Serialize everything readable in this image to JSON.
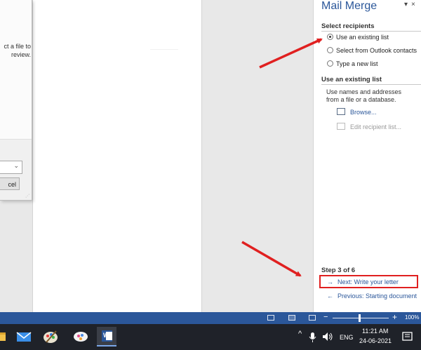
{
  "dialog": {
    "text_line1": "ct a file to",
    "text_line2": "review.",
    "cancel_label": "cel"
  },
  "pane": {
    "title": "Mail Merge",
    "dropdown_glyph": "▾",
    "close_glyph": "×",
    "select_recipients": {
      "heading": "Select recipients",
      "options": [
        {
          "label": "Use an existing list",
          "selected": true
        },
        {
          "label": "Select from Outlook contacts",
          "selected": false
        },
        {
          "label": "Type a new list",
          "selected": false
        }
      ]
    },
    "existing_list": {
      "heading": "Use an existing list",
      "description_line1": "Use names and addresses",
      "description_line2": "from a file or a database.",
      "browse_label": "Browse...",
      "edit_label": "Edit recipient list..."
    },
    "step": {
      "label": "Step 3 of 6",
      "next_label": "Next: Write your letter",
      "previous_label": "Previous: Starting document"
    }
  },
  "statusbar": {
    "zoom_minus": "−",
    "zoom_plus": "+",
    "zoom_percent": "100%",
    "zoom_level": 1.0
  },
  "taskbar": {
    "word_icon_text": "W",
    "language": "ENG",
    "time": "11:21 AM",
    "date": "24-06-2021",
    "caret": "^"
  },
  "colors": {
    "accent": "#2b579a",
    "highlight": "#e02020",
    "taskbar": "#1f2229"
  }
}
